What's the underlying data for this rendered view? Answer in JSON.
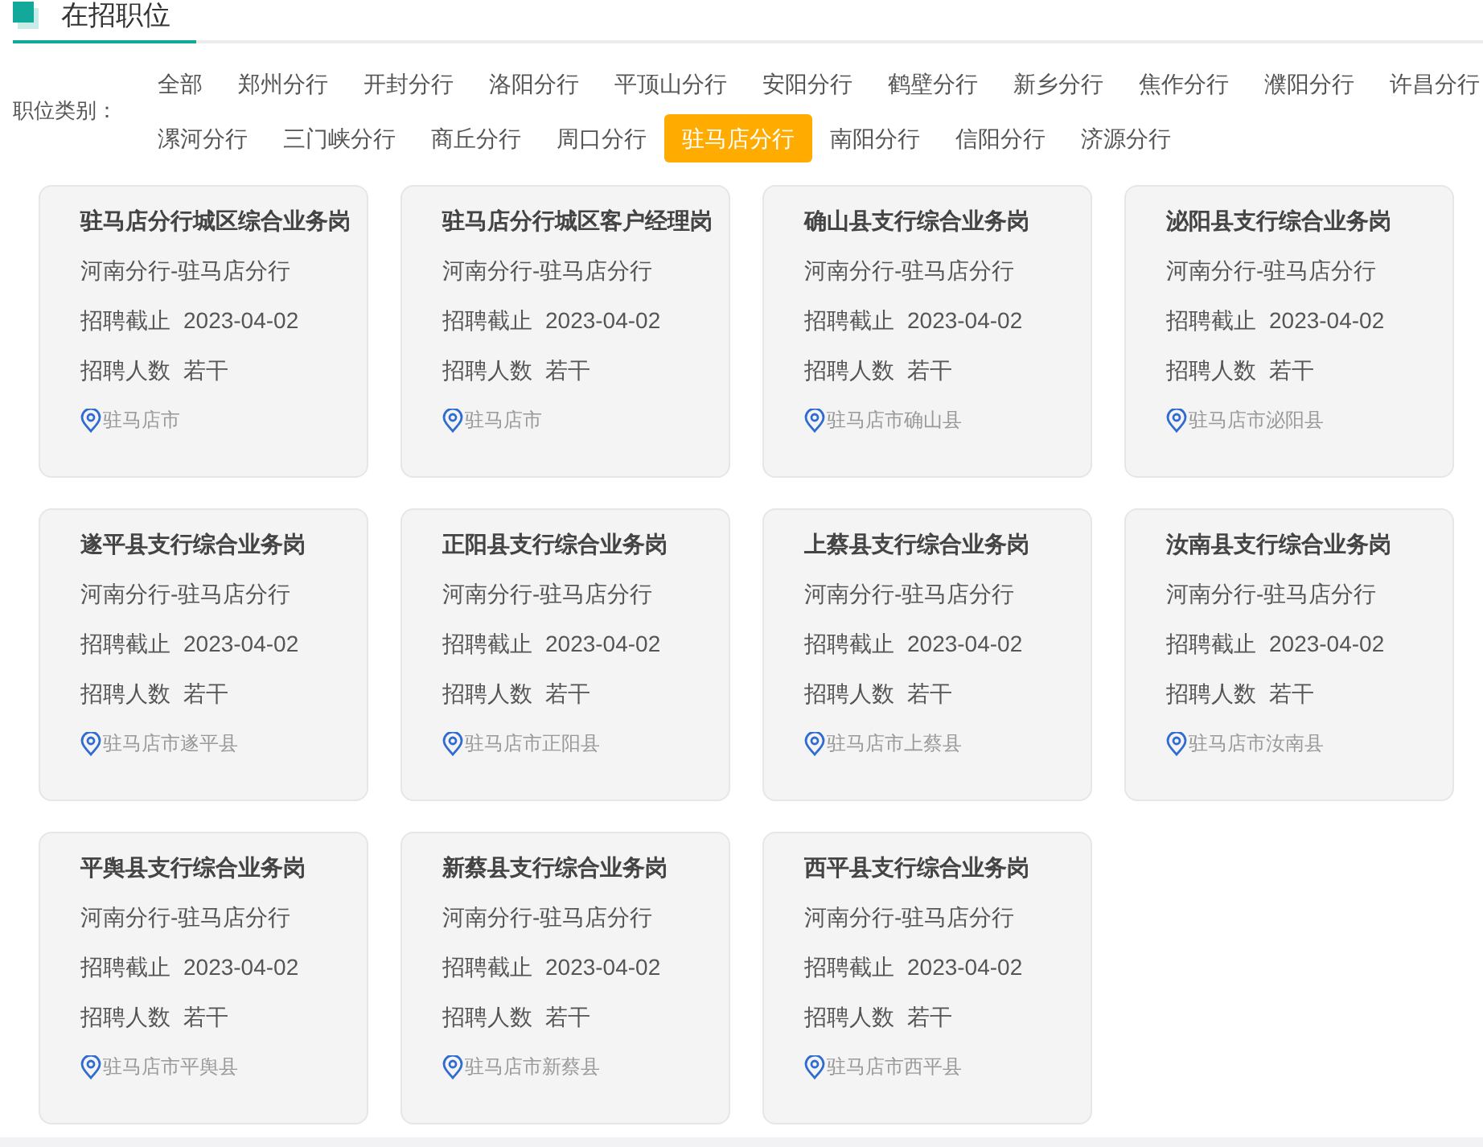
{
  "header": {
    "title": "在招职位"
  },
  "filter": {
    "label": "职位类别：",
    "rows": [
      [
        {
          "label": "全部",
          "selected": false
        },
        {
          "label": "郑州分行",
          "selected": false
        },
        {
          "label": "开封分行",
          "selected": false
        },
        {
          "label": "洛阳分行",
          "selected": false
        },
        {
          "label": "平顶山分行",
          "selected": false
        },
        {
          "label": "安阳分行",
          "selected": false
        },
        {
          "label": "鹤壁分行",
          "selected": false
        },
        {
          "label": "新乡分行",
          "selected": false
        },
        {
          "label": "焦作分行",
          "selected": false
        },
        {
          "label": "濮阳分行",
          "selected": false
        },
        {
          "label": "许昌分行",
          "selected": false
        }
      ],
      [
        {
          "label": "漯河分行",
          "selected": false
        },
        {
          "label": "三门峡分行",
          "selected": false
        },
        {
          "label": "商丘分行",
          "selected": false
        },
        {
          "label": "周口分行",
          "selected": false
        },
        {
          "label": "驻马店分行",
          "selected": true
        },
        {
          "label": "南阳分行",
          "selected": false
        },
        {
          "label": "信阳分行",
          "selected": false
        },
        {
          "label": "济源分行",
          "selected": false
        }
      ]
    ]
  },
  "jobs": [
    {
      "title": "驻马店分行城区综合业务岗",
      "branch": "河南分行-驻马店分行",
      "deadline_label": "招聘截止",
      "deadline": "2023-04-02",
      "count_label": "招聘人数",
      "count": "若干",
      "location": "驻马店市"
    },
    {
      "title": "驻马店分行城区客户经理岗",
      "branch": "河南分行-驻马店分行",
      "deadline_label": "招聘截止",
      "deadline": "2023-04-02",
      "count_label": "招聘人数",
      "count": "若干",
      "location": "驻马店市"
    },
    {
      "title": "确山县支行综合业务岗",
      "branch": "河南分行-驻马店分行",
      "deadline_label": "招聘截止",
      "deadline": "2023-04-02",
      "count_label": "招聘人数",
      "count": "若干",
      "location": "驻马店市确山县"
    },
    {
      "title": "泌阳县支行综合业务岗",
      "branch": "河南分行-驻马店分行",
      "deadline_label": "招聘截止",
      "deadline": "2023-04-02",
      "count_label": "招聘人数",
      "count": "若干",
      "location": "驻马店市泌阳县"
    },
    {
      "title": "遂平县支行综合业务岗",
      "branch": "河南分行-驻马店分行",
      "deadline_label": "招聘截止",
      "deadline": "2023-04-02",
      "count_label": "招聘人数",
      "count": "若干",
      "location": "驻马店市遂平县"
    },
    {
      "title": "正阳县支行综合业务岗",
      "branch": "河南分行-驻马店分行",
      "deadline_label": "招聘截止",
      "deadline": "2023-04-02",
      "count_label": "招聘人数",
      "count": "若干",
      "location": "驻马店市正阳县"
    },
    {
      "title": "上蔡县支行综合业务岗",
      "branch": "河南分行-驻马店分行",
      "deadline_label": "招聘截止",
      "deadline": "2023-04-02",
      "count_label": "招聘人数",
      "count": "若干",
      "location": "驻马店市上蔡县"
    },
    {
      "title": "汝南县支行综合业务岗",
      "branch": "河南分行-驻马店分行",
      "deadline_label": "招聘截止",
      "deadline": "2023-04-02",
      "count_label": "招聘人数",
      "count": "若干",
      "location": "驻马店市汝南县"
    },
    {
      "title": "平舆县支行综合业务岗",
      "branch": "河南分行-驻马店分行",
      "deadline_label": "招聘截止",
      "deadline": "2023-04-02",
      "count_label": "招聘人数",
      "count": "若干",
      "location": "驻马店市平舆县"
    },
    {
      "title": "新蔡县支行综合业务岗",
      "branch": "河南分行-驻马店分行",
      "deadline_label": "招聘截止",
      "deadline": "2023-04-02",
      "count_label": "招聘人数",
      "count": "若干",
      "location": "驻马店市新蔡县"
    },
    {
      "title": "西平县支行综合业务岗",
      "branch": "河南分行-驻马店分行",
      "deadline_label": "招聘截止",
      "deadline": "2023-04-02",
      "count_label": "招聘人数",
      "count": "若干",
      "location": "驻马店市西平县"
    }
  ]
}
